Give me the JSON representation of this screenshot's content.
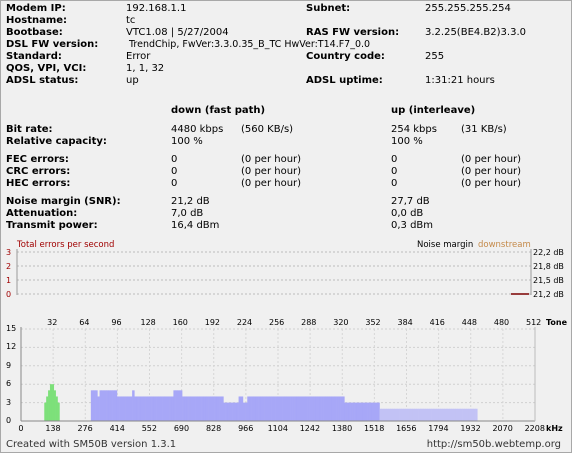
{
  "info": {
    "modem_ip": {
      "label": "Modem IP:",
      "value": "192.168.1.1"
    },
    "subnet": {
      "label": "Subnet:",
      "value": "255.255.255.254"
    },
    "hostname": {
      "label": "Hostname:",
      "value": "tc"
    },
    "bootbase": {
      "label": "Bootbase:",
      "value": "VTC1.08 | 5/27/2004"
    },
    "ras_fw": {
      "label": "RAS FW version:",
      "value": "3.2.25(BE4.B2)3.3.0"
    },
    "dsl_fw": {
      "label": "DSL FW version:",
      "value": "TrendChip, FwVer:3.3.0.35_B_TC HwVer:T14.F7_0.0"
    },
    "standard": {
      "label": "Standard:",
      "value": "Error"
    },
    "country": {
      "label": "Country code:",
      "value": "255"
    },
    "qos": {
      "label": "QOS, VPI, VCI:",
      "value": "1, 1, 32"
    },
    "adsl_status": {
      "label": "ADSL status:",
      "value": "up"
    },
    "adsl_uptime": {
      "label": "ADSL uptime:",
      "value": "1:31:21 hours"
    }
  },
  "stats": {
    "down_header": "down (fast path)",
    "up_header": "up (interleave)",
    "bitrate": {
      "label": "Bit rate:",
      "down": "4480 kbps",
      "down2": "(560 KB/s)",
      "up": "254 kbps",
      "up2": "(31 KB/s)"
    },
    "capacity": {
      "label": "Relative capacity:",
      "down": "100 %",
      "up": "100 %"
    },
    "fec": {
      "label": "FEC errors:",
      "down": "0",
      "down2": "(0 per hour)",
      "up": "0",
      "up2": "(0 per hour)"
    },
    "crc": {
      "label": "CRC errors:",
      "down": "0",
      "down2": "(0 per hour)",
      "up": "0",
      "up2": "(0 per hour)"
    },
    "hec": {
      "label": "HEC errors:",
      "down": "0",
      "down2": "(0 per hour)",
      "up": "0",
      "up2": "(0 per hour)"
    },
    "snr": {
      "label": "Noise margin (SNR):",
      "down": "21,2 dB",
      "up": "27,7 dB"
    },
    "atten": {
      "label": "Attenuation:",
      "down": "7,0 dB",
      "up": "0,0 dB"
    },
    "power": {
      "label": "Transmit power:",
      "down": "16,4 dBm",
      "up": "0,3 dBm"
    }
  },
  "errors_chart": {
    "title": "Total errors per second",
    "legend_noise": "Noise margin",
    "legend_down": "downstream",
    "y_left": [
      "3",
      "2",
      "1",
      "0"
    ],
    "y_right": [
      "22,2 dB",
      "21,8 dB",
      "21,5 dB",
      "21,2 dB"
    ],
    "colors": {
      "errors": "#a00000",
      "noise": "#c58a4a",
      "noise_line": "#7a0000"
    }
  },
  "chart_data": {
    "type": "bar",
    "xlabel": "kHz",
    "x_bottom_ticks": [
      "0",
      "138",
      "276",
      "414",
      "552",
      "690",
      "828",
      "966",
      "1104",
      "1242",
      "1380",
      "1518",
      "1656",
      "1794",
      "1932",
      "2070",
      "2208"
    ],
    "x_top_ticks": [
      "32",
      "64",
      "96",
      "128",
      "160",
      "192",
      "224",
      "256",
      "288",
      "320",
      "352",
      "384",
      "416",
      "448",
      "480",
      "512"
    ],
    "x_top_label": "Tone",
    "y_ticks": [
      "15",
      "12",
      "9",
      "6",
      "3",
      "0"
    ],
    "ylim": [
      0,
      15
    ],
    "series": [
      {
        "range_khz": [
          100,
          165
        ],
        "values": [
          3,
          4,
          5,
          6,
          6,
          5,
          4,
          3
        ],
        "color": "#7de07a"
      },
      {
        "range_khz": [
          300,
          720
        ],
        "values": [
          5,
          5,
          5,
          4,
          5,
          5,
          5,
          5,
          5,
          5,
          5,
          5,
          4,
          4,
          4,
          4,
          4,
          4,
          4,
          5,
          4,
          4,
          4,
          4,
          4,
          4,
          4,
          4,
          4,
          4,
          4,
          4,
          4,
          4,
          4,
          4,
          4,
          4,
          5,
          5,
          5,
          5,
          4,
          4,
          4
        ],
        "color": "#a7a7f7"
      },
      {
        "range_khz": [
          720,
          1140
        ],
        "values": [
          4,
          4,
          4,
          4,
          4,
          4,
          4,
          4,
          4,
          4,
          4,
          4,
          4,
          4,
          4,
          4,
          3,
          3,
          3,
          3,
          3,
          3,
          3,
          4,
          4,
          3,
          3,
          4,
          4,
          4,
          4,
          4,
          4,
          4,
          4,
          4,
          4,
          4,
          4,
          4,
          4,
          4,
          4,
          4,
          4
        ],
        "color": "#a7a7f7"
      },
      {
        "range_khz": [
          1140,
          1540
        ],
        "values": [
          4,
          4,
          4,
          4,
          4,
          4,
          4,
          4,
          4,
          4,
          4,
          4,
          4,
          4,
          4,
          4,
          4,
          4,
          4,
          4,
          4,
          4,
          4,
          4,
          4,
          4,
          4,
          4,
          3,
          3,
          3,
          3,
          3,
          3,
          3,
          3,
          3,
          3,
          3,
          3,
          3,
          3,
          3,
          3,
          3
        ],
        "color": "#a7a7f7"
      },
      {
        "range_khz": [
          1540,
          1960
        ],
        "values": [
          2,
          2,
          2,
          2,
          2,
          2,
          2,
          2,
          2,
          2,
          2,
          2,
          2,
          2,
          2,
          2,
          2,
          2,
          2,
          2,
          2,
          2,
          2,
          2,
          2,
          2,
          2,
          2,
          2,
          2,
          2,
          2,
          2,
          2,
          2,
          2,
          2,
          2,
          2,
          2,
          2,
          2,
          2,
          2,
          2
        ],
        "color": "#c2c2f5"
      }
    ]
  },
  "footer": {
    "left": "Created with SM50B version 1.3.1",
    "right": "http://sm50b.webtemp.org"
  }
}
